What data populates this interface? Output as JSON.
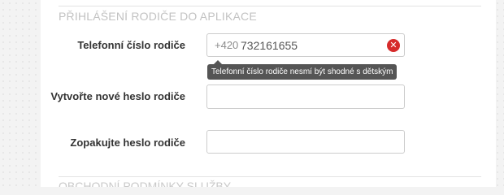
{
  "section": {
    "title": "PŘIHLÁŠENÍ RODIČE DO APLIKACE",
    "next_title": "OBCHODNÍ PODMÍNKY SLUŽBY"
  },
  "form": {
    "phone": {
      "label": "Telefonní číslo rodiče",
      "prefix": "+420",
      "value": "732161655",
      "error_tooltip": "Telefonní číslo rodiče nesmí být shodné s dětským"
    },
    "new_password": {
      "label": "Vytvořte nové heslo rodiče",
      "value": ""
    },
    "repeat_password": {
      "label": "Zopakujte heslo rodiče",
      "value": ""
    }
  },
  "icons": {
    "error": "error-circle-icon"
  },
  "colors": {
    "error": "#d62b2b",
    "tooltip_bg": "#555555"
  }
}
